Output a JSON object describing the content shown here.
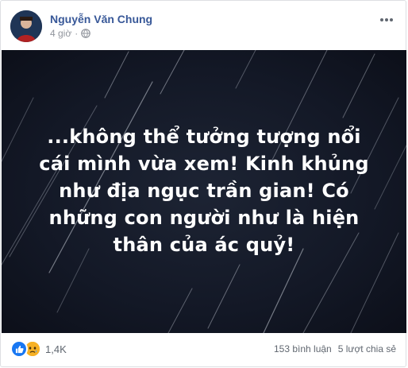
{
  "post": {
    "author": "Nguyễn Văn Chung",
    "time": "4 giờ",
    "separator": "·",
    "text_lines": [
      "...không thể tưởng tượng nổi",
      "cái mình vừa xem! Kinh khủng",
      "như địa ngục trần gian! Có",
      "những con người như là hiện",
      "thân của ác quỷ!"
    ],
    "background_color": "#151a27"
  },
  "icons": {
    "privacy": "globe-icon",
    "more": "more-options-icon",
    "reaction_1": "like-icon",
    "reaction_2": "sad-icon"
  },
  "footer": {
    "reaction_count": "1,4K",
    "comments": "153 bình luận",
    "shares": "5 lượt chia sẻ"
  },
  "colors": {
    "author_link": "#385898",
    "meta_gray": "#90949c",
    "like_blue": "#1877f2",
    "sad_yellow": "#f7b125"
  }
}
